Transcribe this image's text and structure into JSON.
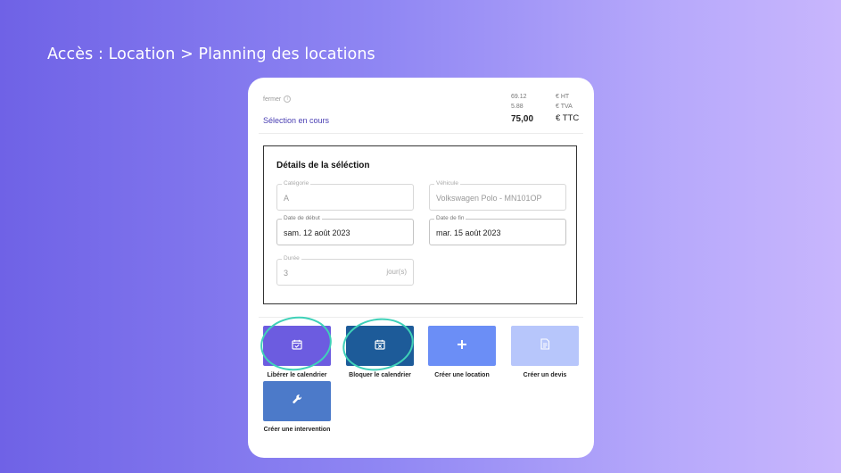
{
  "breadcrumb": "Accès : Location > Planning des locations",
  "panel": {
    "close_label": "fermer",
    "info_icon": "info-icon",
    "selection_title": "Sélection en cours",
    "totals": {
      "ht_amount": "69.12",
      "ht_unit": "€ HT",
      "tva_amount": "5.88",
      "tva_unit": "€ TVA",
      "ttc_amount": "75,00",
      "ttc_unit": "€ TTC"
    }
  },
  "details": {
    "title": "Détails de la séléction",
    "categorie_label": "Catégorie",
    "categorie_value": "A",
    "vehicule_label": "Véhicule",
    "vehicule_value": "Volkswagen Polo - MN101OP",
    "date_debut_label": "Date de début",
    "date_debut_value": "sam. 12 août 2023",
    "date_fin_label": "Date de fin",
    "date_fin_value": "mar. 15 août 2023",
    "duree_label": "Durée",
    "duree_value": "3",
    "duree_unit": "jour(s)"
  },
  "actions": [
    {
      "label": "Libérer le calendrier",
      "icon": "calendar-check-icon",
      "color": "#6c5ce0"
    },
    {
      "label": "Bloquer le calendrier",
      "icon": "calendar-x-icon",
      "color": "#1d5b99"
    },
    {
      "label": "Créer une location",
      "icon": "plus-icon",
      "color": "#6b8ef6"
    },
    {
      "label": "Créer un devis",
      "icon": "document-icon",
      "color": "#b7c6fb"
    },
    {
      "label": "Créer une intervention",
      "icon": "wrench-icon",
      "color": "#4c7ac9"
    }
  ],
  "highlight_color": "#3fd1b8"
}
